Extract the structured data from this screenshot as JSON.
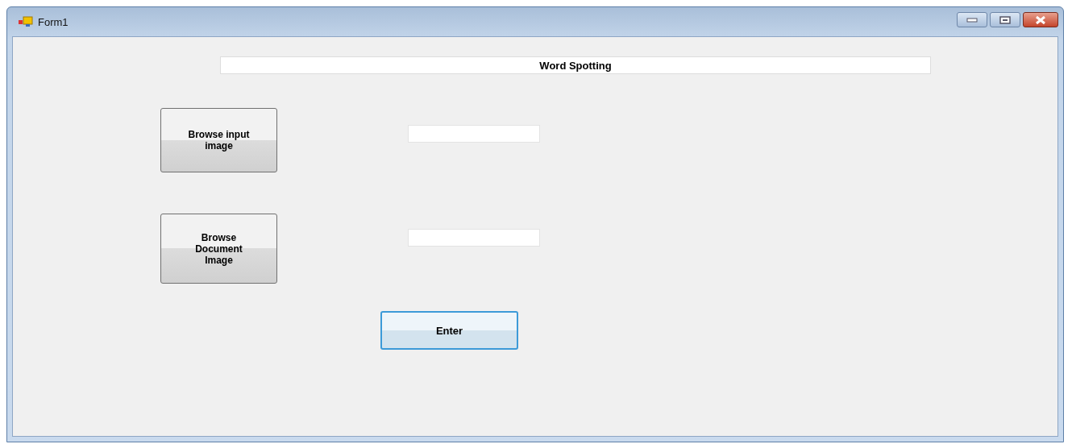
{
  "window": {
    "title": "Form1"
  },
  "title_box": {
    "text": "Word Spotting"
  },
  "browse_rows": [
    {
      "button": "Browse input image"
    },
    {
      "button": "Browse Document Image"
    }
  ],
  "enter_button": {
    "label": "Enter",
    "default": true
  }
}
